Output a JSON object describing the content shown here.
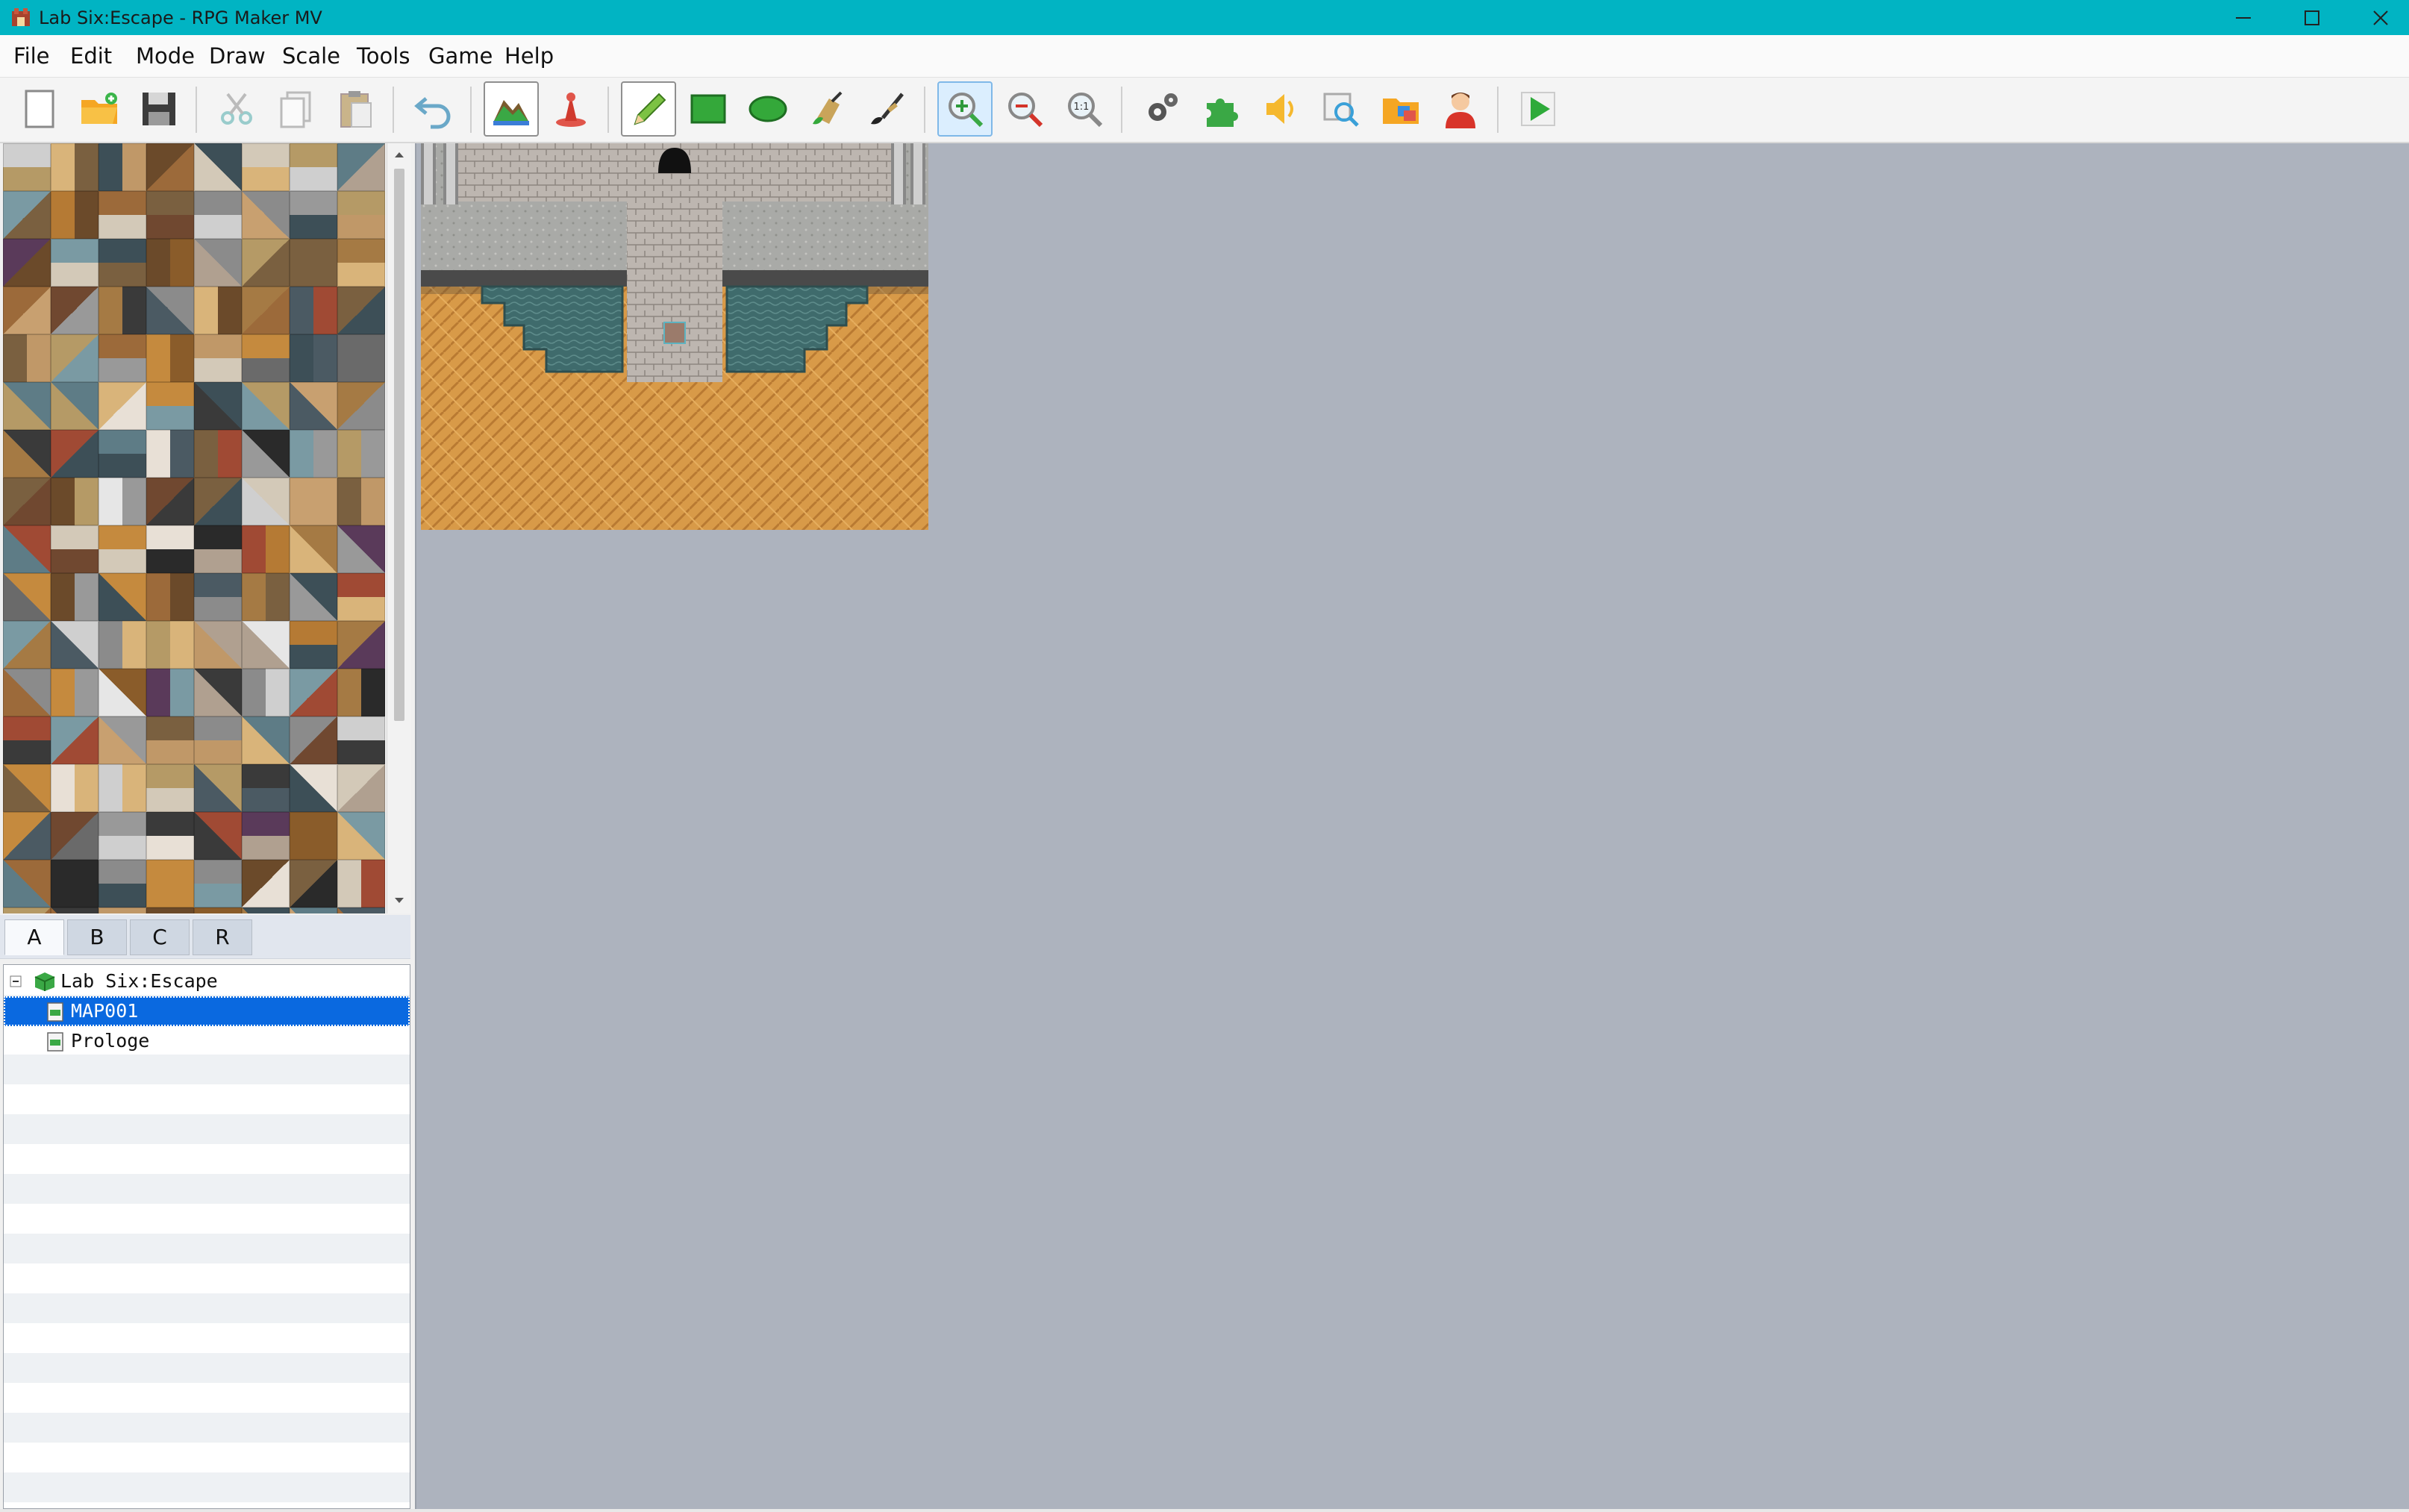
{
  "window": {
    "title": "Lab Six:Escape - RPG Maker MV",
    "app_icon": "rpgmaker-icon",
    "controls": [
      "minimize-icon",
      "maximize-icon",
      "close-icon"
    ]
  },
  "menubar": {
    "items": [
      "File",
      "Edit",
      "Mode",
      "Draw",
      "Scale",
      "Tools",
      "Game",
      "Help"
    ]
  },
  "toolbar": {
    "tools": [
      {
        "name": "new-project",
        "icon": "new-file-icon"
      },
      {
        "name": "open-project",
        "icon": "open-folder-icon"
      },
      {
        "name": "save-project",
        "icon": "save-icon"
      },
      {
        "name": "cut",
        "icon": "scissors-icon"
      },
      {
        "name": "copy",
        "icon": "copy-icon"
      },
      {
        "name": "paste",
        "icon": "paste-icon"
      },
      {
        "name": "undo",
        "icon": "undo-icon"
      },
      {
        "name": "map-mode",
        "icon": "map-mode-icon",
        "selected": true
      },
      {
        "name": "event-mode",
        "icon": "event-mode-icon"
      },
      {
        "name": "pencil",
        "icon": "pencil-icon",
        "selected": true
      },
      {
        "name": "rectangle",
        "icon": "rectangle-icon"
      },
      {
        "name": "ellipse",
        "icon": "ellipse-icon"
      },
      {
        "name": "flood-fill",
        "icon": "fill-icon"
      },
      {
        "name": "shadow-pen",
        "icon": "shadow-pen-icon"
      },
      {
        "name": "zoom-in",
        "icon": "zoom-in-icon",
        "selected": true
      },
      {
        "name": "zoom-out",
        "icon": "zoom-out-icon"
      },
      {
        "name": "actual-size",
        "icon": "zoom-actual-icon",
        "label": "1:1"
      },
      {
        "name": "database",
        "icon": "database-gear-icon"
      },
      {
        "name": "plugin-manager",
        "icon": "plugin-icon"
      },
      {
        "name": "sound-test",
        "icon": "speaker-icon"
      },
      {
        "name": "event-searcher",
        "icon": "search-icon"
      },
      {
        "name": "resource-manager",
        "icon": "resource-folder-icon"
      },
      {
        "name": "character-generator",
        "icon": "character-icon"
      },
      {
        "name": "playtest",
        "icon": "play-icon"
      }
    ]
  },
  "tileset_tabs": {
    "items": [
      "A",
      "B",
      "C",
      "R"
    ],
    "active": "A"
  },
  "map_tree": {
    "project": "Lab Six:Escape",
    "maps": [
      {
        "name": "MAP001",
        "selected": true
      },
      {
        "name": "Prologe",
        "selected": false
      }
    ]
  },
  "colors": {
    "titlebar": "#01b4c3",
    "selection": "#0a69e0",
    "map_background": "#adb3be"
  }
}
